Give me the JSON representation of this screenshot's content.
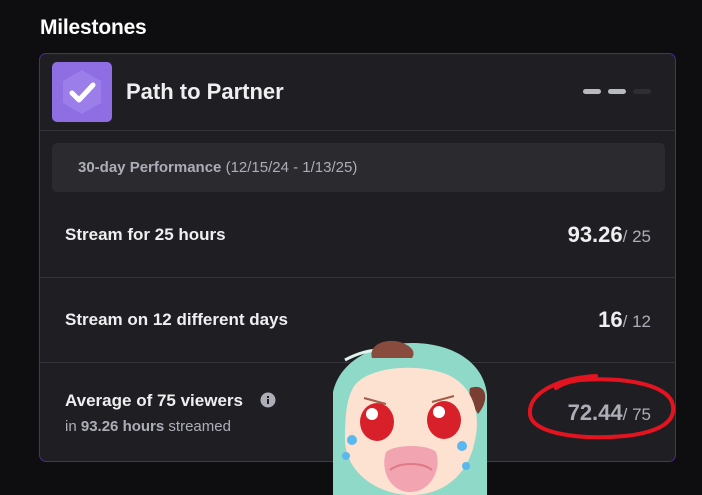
{
  "section_title": "Milestones",
  "card": {
    "title": "Path to Partner",
    "badge_icon": "checkmark-shield-icon",
    "steps": [
      {
        "state": "complete"
      },
      {
        "state": "complete"
      },
      {
        "state": "incomplete"
      }
    ]
  },
  "performance": {
    "label": "30-day Performance",
    "range": "(12/15/24 - 1/13/25)"
  },
  "goals": [
    {
      "label": "Stream for 25 hours",
      "value": "93.26",
      "target": "/ 25"
    },
    {
      "label": "Stream on 12 different days",
      "value": "16",
      "target": "/ 12"
    },
    {
      "label": "Average of 75 viewers",
      "sub_prefix": "in",
      "sub_hours": "93.26 hours",
      "sub_suffix": "streamed",
      "value": "72.44",
      "target": "/ 75",
      "info_icon": "info-icon"
    }
  ],
  "colors": {
    "background": "#0e0e10",
    "card": "#1f1f23",
    "card_border": "#4b2a8a",
    "badge": "#8e6ee2",
    "annotation": "#e3141f"
  }
}
